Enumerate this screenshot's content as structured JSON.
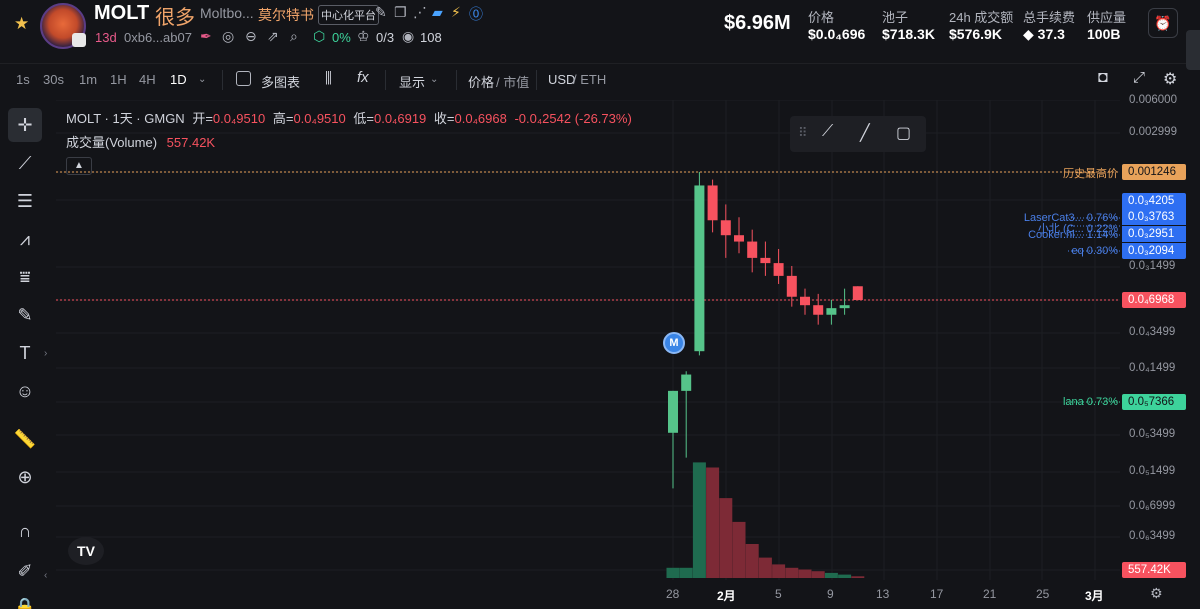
{
  "header": {
    "token_name": "MOLT",
    "token_cn": "很多",
    "token_full": "Moltbo...",
    "author": "莫尔特书",
    "cex_badge": "中心化平台",
    "age": "13d",
    "address": "0xb6...ab07",
    "holder_pct": "0%",
    "count": "0/3",
    "views": "108",
    "market_cap": "$6.96M",
    "stats": [
      {
        "label": "价格",
        "value": "$0.0₄696"
      },
      {
        "label": "池子",
        "value": "$718.3K"
      },
      {
        "label": "24h 成交额",
        "value": "$576.9K"
      },
      {
        "label": "总手续费",
        "value": "37.3"
      },
      {
        "label": "供应量",
        "value": "100B"
      }
    ]
  },
  "toolbar": {
    "timeframes": [
      "1s",
      "30s",
      "1m",
      "1H",
      "4H",
      "1D"
    ],
    "active_timeframe": "1D",
    "multi_chart": "多图表",
    "display": "显示",
    "price_toggle": "价格",
    "mcap_toggle": "/ 市值",
    "currency": "USD",
    "currency_alt": "/ ETH"
  },
  "legend": {
    "symbol": "MOLT · 1天 · GMGN",
    "open_label": "开=",
    "open": "0.0₄9510",
    "high_label": "高=",
    "high": "0.0₄9510",
    "low_label": "低=",
    "low": "0.0₄6919",
    "close_label": "收=",
    "close": "0.0₄6968",
    "change": "-0.0₄2542 (-26.73%)",
    "volume_label": "成交量(Volume)",
    "volume": "557.42K"
  },
  "annotations": {
    "ath_label": "历史最高价",
    "ath_value": "0.001246",
    "tags": [
      {
        "label": "LaserCat3... 0.76%",
        "value": "0.0₃4205"
      },
      {
        "label": "小北 (C... 0.22%",
        "value": "0.0₃3763"
      },
      {
        "label": "Cooker.hl... 1.14%",
        "value": "0.0₃2951"
      },
      {
        "label": "eq 0.30%",
        "value": "0.0₃2094"
      }
    ],
    "current_price": "0.0₄6968",
    "lana_label": "lana 0.73%",
    "lana_value": "0.0₅7366",
    "volume_tag": "557.42K",
    "marker": "M"
  },
  "y_axis": [
    "0.006000",
    "0.002999",
    "0.0₃1499",
    "0.0₄3499",
    "0.0₄1499",
    "0.0₅3499",
    "0.0₅1499",
    "0.0₆6999",
    "0.0₆3499"
  ],
  "x_axis": [
    "28",
    "2月",
    "5",
    "9",
    "13",
    "17",
    "21",
    "25",
    "3月"
  ],
  "chart_data": {
    "type": "candlestick",
    "price_axis_log": true,
    "candles": [
      {
        "o": 3.5e-06,
        "h": 9e-06,
        "l": 1e-06,
        "c": 9e-06
      },
      {
        "o": 9e-06,
        "h": 1.4e-05,
        "l": 2e-06,
        "c": 1.3e-05
      },
      {
        "o": 2.2e-05,
        "h": 0.001246,
        "l": 2e-05,
        "c": 0.00092
      },
      {
        "o": 0.00092,
        "h": 0.00105,
        "l": 0.00032,
        "c": 0.00042
      },
      {
        "o": 0.00042,
        "h": 0.0006,
        "l": 0.00018,
        "c": 0.0003
      },
      {
        "o": 0.0003,
        "h": 0.00045,
        "l": 0.0002,
        "c": 0.00026
      },
      {
        "o": 0.00026,
        "h": 0.00034,
        "l": 0.00013,
        "c": 0.00018
      },
      {
        "o": 0.00018,
        "h": 0.00026,
        "l": 0.00012,
        "c": 0.00016
      },
      {
        "o": 0.00016,
        "h": 0.00022,
        "l": 0.0001,
        "c": 0.00012
      },
      {
        "o": 0.00012,
        "h": 0.00015,
        "l": 6e-05,
        "c": 7.5e-05
      },
      {
        "o": 7.5e-05,
        "h": 9e-05,
        "l": 5e-05,
        "c": 6.2e-05
      },
      {
        "o": 6.2e-05,
        "h": 8e-05,
        "l": 4e-05,
        "c": 5e-05
      },
      {
        "o": 5e-05,
        "h": 7e-05,
        "l": 4e-05,
        "c": 5.8e-05
      },
      {
        "o": 5.8e-05,
        "h": 9e-05,
        "l": 5e-05,
        "c": 6.2e-05
      },
      {
        "o": 9.5e-05,
        "h": 9.5e-05,
        "l": 6.9e-05,
        "c": 6.97e-05
      }
    ],
    "volume_level": [
      0.06,
      0.06,
      0.68,
      0.65,
      0.47,
      0.33,
      0.2,
      0.12,
      0.08,
      0.06,
      0.05,
      0.04,
      0.03,
      0.02,
      0.01
    ]
  },
  "colors": {
    "up": "#56c48a",
    "down": "#f7525f",
    "up_volume": "#1f6b4f",
    "down_volume": "#7d2a36",
    "ath_line": "#e8a25a",
    "tag_blue": "#2e6ff2",
    "current_tag": "#f7525f",
    "lana_green": "#3dd39b"
  }
}
